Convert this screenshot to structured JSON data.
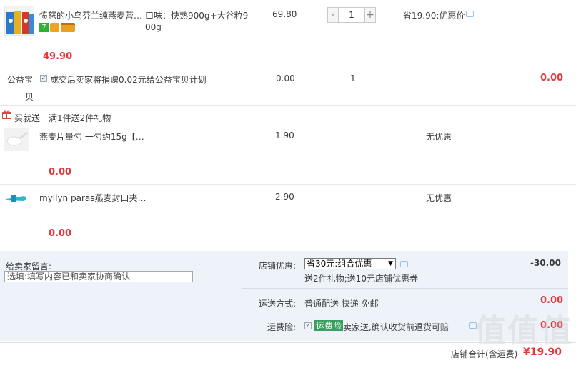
{
  "main_item": {
    "title": "愤怒的小鸟芬兰纯燕麦营…",
    "spec_line1": "口味：快熟900g+大谷粒9",
    "spec_line2": "00g",
    "unit_price": "69.80",
    "quantity": "1",
    "promo": "省19.90:优惠价",
    "subtotal": "49.90",
    "badge_colors": [
      "#2eb135",
      "#f0a31c",
      "#e8a020"
    ]
  },
  "charity": {
    "label_line1": "公益宝",
    "label_line2": "贝",
    "text": "成交后卖家将捐赠0.02元给公益宝贝计划",
    "price": "0.00",
    "quantity": "1",
    "subtotal": "0.00"
  },
  "gift_header": {
    "tag": "买就送",
    "text": "满1件送2件礼物"
  },
  "gifts": [
    {
      "title": "燕麦片量勺 一勺约15g【…",
      "price": "1.90",
      "promo": "无优惠",
      "subtotal": "0.00"
    },
    {
      "title": "myllyn paras燕麦封口夹…",
      "price": "2.90",
      "promo": "无优惠",
      "subtotal": "0.00"
    }
  ],
  "seller_message": {
    "label": "给卖家留言:",
    "placeholder": "选填:填写内容已和卖家协商确认"
  },
  "shop_discount": {
    "label": "店铺优惠:",
    "selected": "省30元:组合优惠",
    "note": "送2件礼物;送10元店铺优惠券",
    "amount": "-30.00"
  },
  "shipping": {
    "label": "运送方式:",
    "value": "普通配送 快递 免邮",
    "amount": "0.00"
  },
  "insurance": {
    "label": "运费险:",
    "tag": "运费险",
    "text": "卖家送,确认收货前退货可赔",
    "amount": "0.00"
  },
  "total": {
    "label": "店铺合计(含运费)",
    "amount": "¥19.90"
  },
  "watermark": "值值值",
  "colors": {
    "price_red": "#e4393c",
    "panel_bg": "#eef3fa",
    "tag_green": "#3a9e5f"
  }
}
